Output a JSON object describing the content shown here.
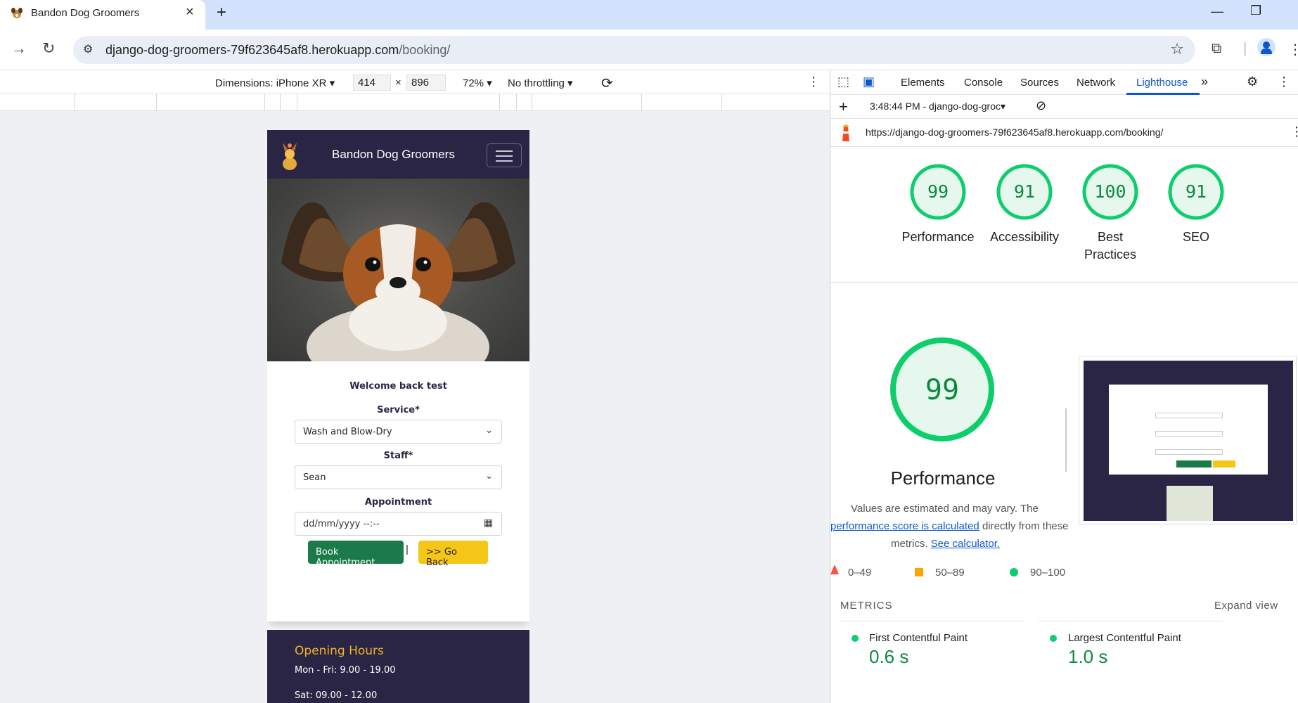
{
  "browser": {
    "tab_title": "Bandon Dog Groomers",
    "url_host": "django-dog-groomers-79f623645af8.herokuapp.com",
    "url_path": "/booking/"
  },
  "device_toolbar": {
    "dimensions_label": "Dimensions: iPhone XR",
    "width": "414",
    "times": "×",
    "height": "896",
    "zoom": "72%",
    "throttling": "No throttling"
  },
  "site": {
    "brand": "Bandon Dog Groomers",
    "welcome": "Welcome back test",
    "service_label": "Service*",
    "service_value": "Wash and Blow-Dry",
    "staff_label": "Staff*",
    "staff_value": "Sean",
    "appointment_label": "Appointment",
    "appointment_placeholder": "dd/mm/yyyy --:--",
    "book_button": "Book Appointment",
    "separator": "|",
    "back_button": ">> Go Back",
    "footer_heading": "Opening Hours",
    "hours_weekday": "Mon - Fri: 9.00 - 19.00",
    "hours_sat": "Sat: 09.00 - 12.00"
  },
  "devtools": {
    "tabs": [
      "Elements",
      "Console",
      "Sources",
      "Network",
      "Lighthouse"
    ],
    "active_tab": "Lighthouse",
    "report_time": "3:48:44 PM - django-dog-groc",
    "report_url": "https://django-dog-groomers-79f623645af8.herokuapp.com/booking/",
    "scores": [
      {
        "label": "Performance",
        "value": 99
      },
      {
        "label": "Accessibility",
        "value": 91
      },
      {
        "label": "Best Practices",
        "value": 100
      },
      {
        "label": "SEO",
        "value": 91
      }
    ],
    "performance": {
      "score": 99,
      "title": "Performance",
      "desc_1": "Values are estimated and may vary. The",
      "desc_link_1": "performance score is calculated",
      "desc_2": "directly from these",
      "desc_3": "metrics.",
      "desc_link_2": "See calculator."
    },
    "legend": {
      "fail": "0–49",
      "average": "50–89",
      "pass": "90–100"
    },
    "metrics_heading": "METRICS",
    "expand_view": "Expand view",
    "metrics": [
      {
        "title": "First Contentful Paint",
        "value": "0.6 s"
      },
      {
        "title": "Largest Contentful Paint",
        "value": "1.0 s"
      }
    ],
    "colors": {
      "pass": "#0cce6b",
      "average": "#ffa400",
      "fail": "#ff4e42",
      "accent": "#0b57d0"
    }
  }
}
